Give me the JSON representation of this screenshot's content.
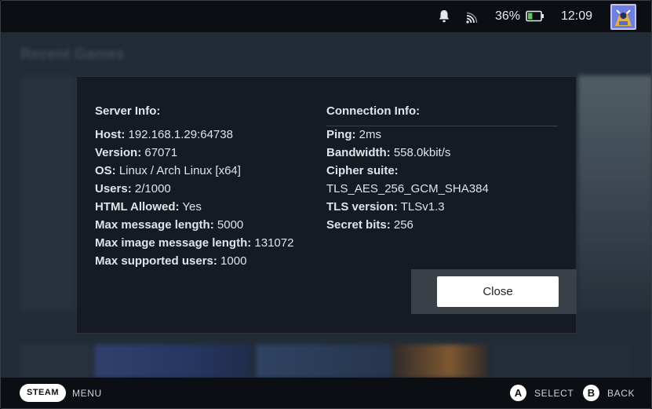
{
  "status_bar": {
    "battery_percent": "36%",
    "battery_level": 0.36,
    "time": "12:09",
    "icons": [
      "bell-icon",
      "cast-icon",
      "battery-icon",
      "avatar"
    ]
  },
  "background": {
    "section_title": "Recent Games"
  },
  "dialog": {
    "server": {
      "title": "Server Info:",
      "rows": [
        {
          "key": "Host:",
          "value": "192.168.1.29:64738"
        },
        {
          "key": "Version:",
          "value": "67071"
        },
        {
          "key": "OS:",
          "value": "Linux / Arch Linux [x64]"
        },
        {
          "key": "Users:",
          "value": "2/1000"
        },
        {
          "key": "HTML Allowed:",
          "value": "Yes"
        },
        {
          "key": "Max message length:",
          "value": "5000"
        },
        {
          "key": "Max image message length:",
          "value": "131072"
        },
        {
          "key": "Max supported users:",
          "value": "1000"
        }
      ]
    },
    "connection": {
      "title": "Connection Info:",
      "rows": [
        {
          "key": "Ping:",
          "value": "2ms"
        },
        {
          "key": "Bandwidth:",
          "value": "558.0kbit/s"
        },
        {
          "key": "Cipher suite:",
          "value": ""
        },
        {
          "key": "",
          "value": "TLS_AES_256_GCM_SHA384"
        },
        {
          "key": "TLS version:",
          "value": "TLSv1.3"
        },
        {
          "key": "Secret bits:",
          "value": "256"
        }
      ]
    },
    "close_label": "Close"
  },
  "bottom_bar": {
    "steam_label": "STEAM",
    "menu_label": "MENU",
    "a_glyph": "A",
    "select_label": "SELECT",
    "b_glyph": "B",
    "back_label": "BACK"
  },
  "colors": {
    "accent_button": "#ffffff",
    "dialog_bg": "#161b23",
    "battery_fill": "#5ac85a"
  }
}
